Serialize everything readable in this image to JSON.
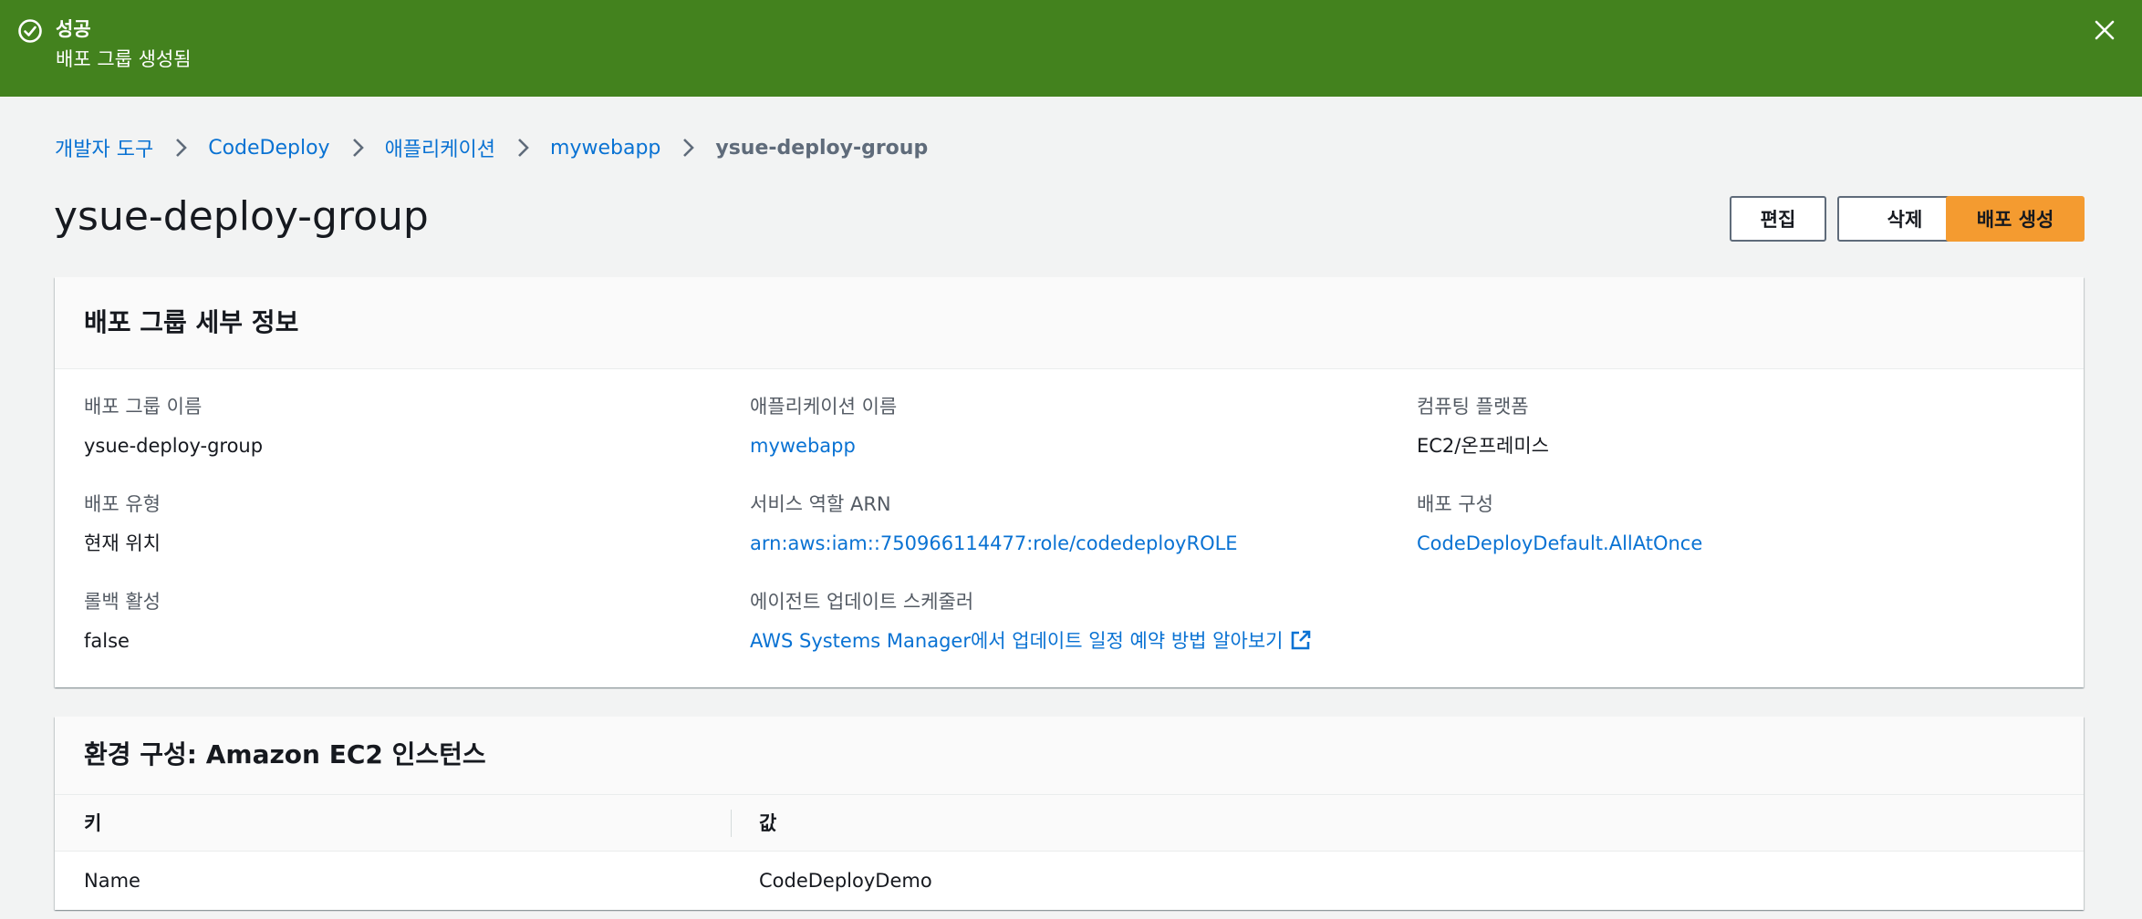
{
  "flash": {
    "title": "성공",
    "message": "배포 그룹 생성됨",
    "icon": "check-circle-icon",
    "close_icon": "close-icon",
    "color": "#43821e"
  },
  "breadcrumb": {
    "items": [
      "개발자 도구",
      "CodeDeploy",
      "애플리케이션",
      "mywebapp"
    ],
    "current": "ysue-deploy-group"
  },
  "page": {
    "title": "ysue-deploy-group"
  },
  "actions": {
    "edit_label": "편집",
    "delete_label": "삭제",
    "create_label": "배포 생성",
    "primary_color": "#f49b30"
  },
  "details": {
    "title": "배포 그룹 세부 정보",
    "deployment_group_name": {
      "label": "배포 그룹 이름",
      "value": "ysue-deploy-group"
    },
    "application_name": {
      "label": "애플리케이션 이름",
      "value": "mywebapp"
    },
    "compute_platform": {
      "label": "컴퓨팅 플랫폼",
      "value": "EC2/온프레미스"
    },
    "deployment_type": {
      "label": "배포 유형",
      "value": "현재 위치"
    },
    "service_role_arn": {
      "label": "서비스 역할 ARN",
      "value": "arn:aws:iam::750966114477:role/codedeployROLE"
    },
    "deployment_config": {
      "label": "배포 구성",
      "value": "CodeDeployDefault.AllAtOnce"
    },
    "rollback_enabled": {
      "label": "롤백 활성",
      "value": "false"
    },
    "agent_scheduler": {
      "label": "에이전트 업데이트 스케줄러",
      "value": "AWS Systems Manager에서 업데이트 일정 예약 방법 알아보기"
    }
  },
  "environment": {
    "title": "환경 구성: Amazon EC2 인스턴스",
    "columns": [
      "키",
      "값"
    ],
    "rows": [
      {
        "key": "Name",
        "value": "CodeDeployDemo"
      }
    ]
  },
  "colors": {
    "link": "#0972d3",
    "text": "#16191f",
    "label": "#545b64"
  }
}
